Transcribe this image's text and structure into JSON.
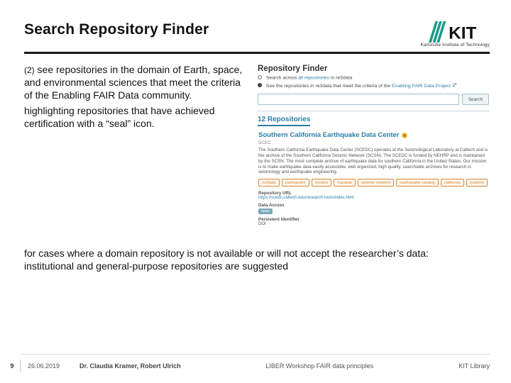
{
  "header": {
    "title": "Search Repository Finder",
    "logo_text": "KIT",
    "logo_sub": "Karlsruhe Institute of Technology"
  },
  "left": {
    "num": "(2)",
    "p1": " see repositories in the domain of Earth, space, and environmental sciences that meet the criteria of the Enabling FAIR Data community.",
    "p2": "highlighting repositories that have achieved certification with a “seal” icon."
  },
  "lower": {
    "p1": "for cases where a domain repository is not available or will not accept the researcher’s data:",
    "p2": "institutional and general-purpose repositories are suggested"
  },
  "finder": {
    "title": "Repository Finder",
    "bullet1_pre": "Search across ",
    "bullet1_link": "all repositories",
    "bullet1_post": " in re3data",
    "bullet2_pre": "See the repositories in re3data that meet the criteria of the ",
    "bullet2_link": "Enabling FAIR Data Project",
    "search_btn": "Search",
    "count_label": "12 Repositories",
    "entry": {
      "title": "Southern California Earthquake Data Center",
      "acronym": "SCEC",
      "desc": "The Southern California Earthquake Data Center (SCEDC) operates at the Seismological Laboratory at Caltech and is the archive of the Southern California Seismic Network (SCSN). The SCEDC is funded by NEHRP and is maintained by the SCSN. The most complete archive of earthquake data for southern California in the United States. Our mission is to make earthquake data easily accessible, well organized, high quality, searchable archives for research in seismology and earthquake engineering.",
      "tags": [
        "re3data",
        "earthquake",
        "models",
        "hazards",
        "seismic network",
        "earthquake catalog",
        "california",
        "realtime"
      ],
      "meta": {
        "url_label": "Repository URL",
        "url": "https://scedc.caltech.edu/research-tools/index.html",
        "access_label": "Data Access",
        "access_badge": "open",
        "pid_label": "Persistent Identifier",
        "pid": "DOI"
      }
    }
  },
  "footer": {
    "page": "9",
    "date": "26.06.2019",
    "authors": "Dr. Claudia Kramer, Robert Ulrich",
    "workshop": "LIBER Workshop FAIR data principles",
    "lib": "KIT Library"
  }
}
